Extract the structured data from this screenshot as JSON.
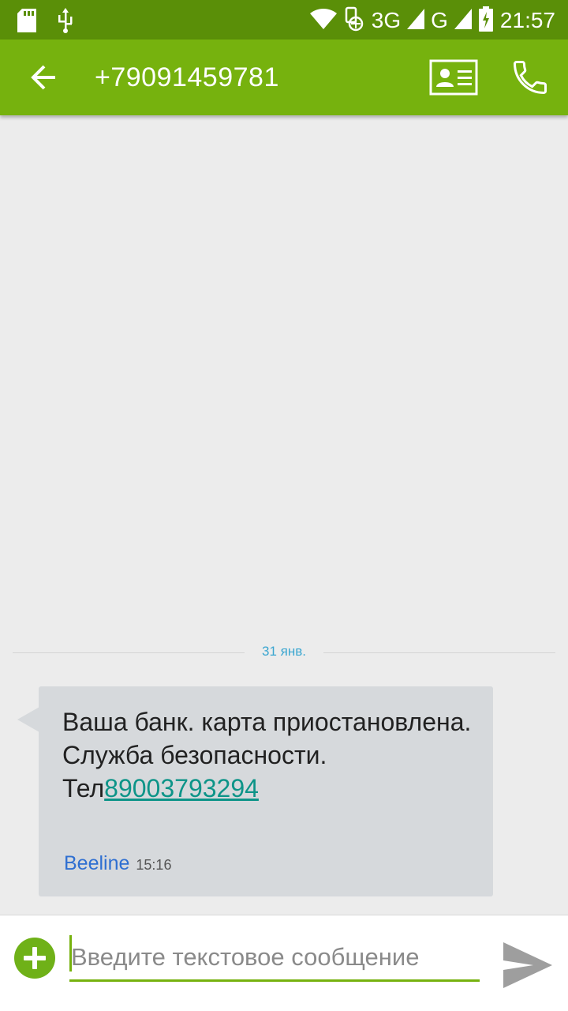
{
  "status_bar": {
    "time": "21:57",
    "network_3g": "3G",
    "network_g": "G",
    "icons": [
      "sd-card-icon",
      "usb-icon",
      "wifi-icon",
      "data-transfer-icon",
      "signal-icon",
      "battery-charging-icon"
    ]
  },
  "app_bar": {
    "title": "+79091459781",
    "icons": [
      "back-arrow-icon",
      "contact-card-icon",
      "phone-icon"
    ]
  },
  "conversation": {
    "date_divider": "31 янв.",
    "message": {
      "text": "Ваша банк. карта приостановлена. Служба безопасности. Тел",
      "link": "89003793294",
      "sender": "Beeline",
      "time": "15:16"
    }
  },
  "compose": {
    "placeholder": "Введите текстовое сообщение",
    "icons": [
      "add-attachment-icon",
      "send-icon"
    ]
  },
  "colors": {
    "status_bar": "#5a8f08",
    "app_bar": "#76b20e",
    "background": "#ececec",
    "bubble": "#d6d9dc",
    "link": "#0d9488",
    "sender": "#2f6fd1",
    "date": "#3aa6d0"
  }
}
